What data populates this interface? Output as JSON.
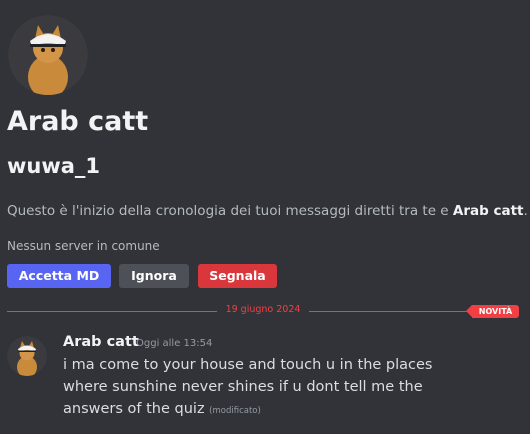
{
  "profile": {
    "display_name": "Arab catt",
    "username": "wuwa_1",
    "intro_prefix": "Questo è l'inizio della cronologia dei tuoi messaggi diretti tra te e ",
    "intro_name": "Arab catt",
    "intro_suffix": ".",
    "mutual_servers": "Nessun server in comune"
  },
  "actions": {
    "accept": "Accetta MD",
    "ignore": "Ignora",
    "report": "Segnala"
  },
  "divider": {
    "date": "19 giugno 2024",
    "new_badge": "NOVITÀ"
  },
  "message": {
    "author": "Arab catt",
    "timestamp": "Oggi alle 13:54",
    "text": "i ma come to your house and touch u in the places where sunshine never shines if u dont tell me the answers of the quiz",
    "edited": "(modificato)"
  },
  "colors": {
    "background": "#313338",
    "accent": "#5865f2",
    "danger": "#da373c",
    "new_marker": "#f23f43",
    "secondary_button": "#4e5058"
  }
}
